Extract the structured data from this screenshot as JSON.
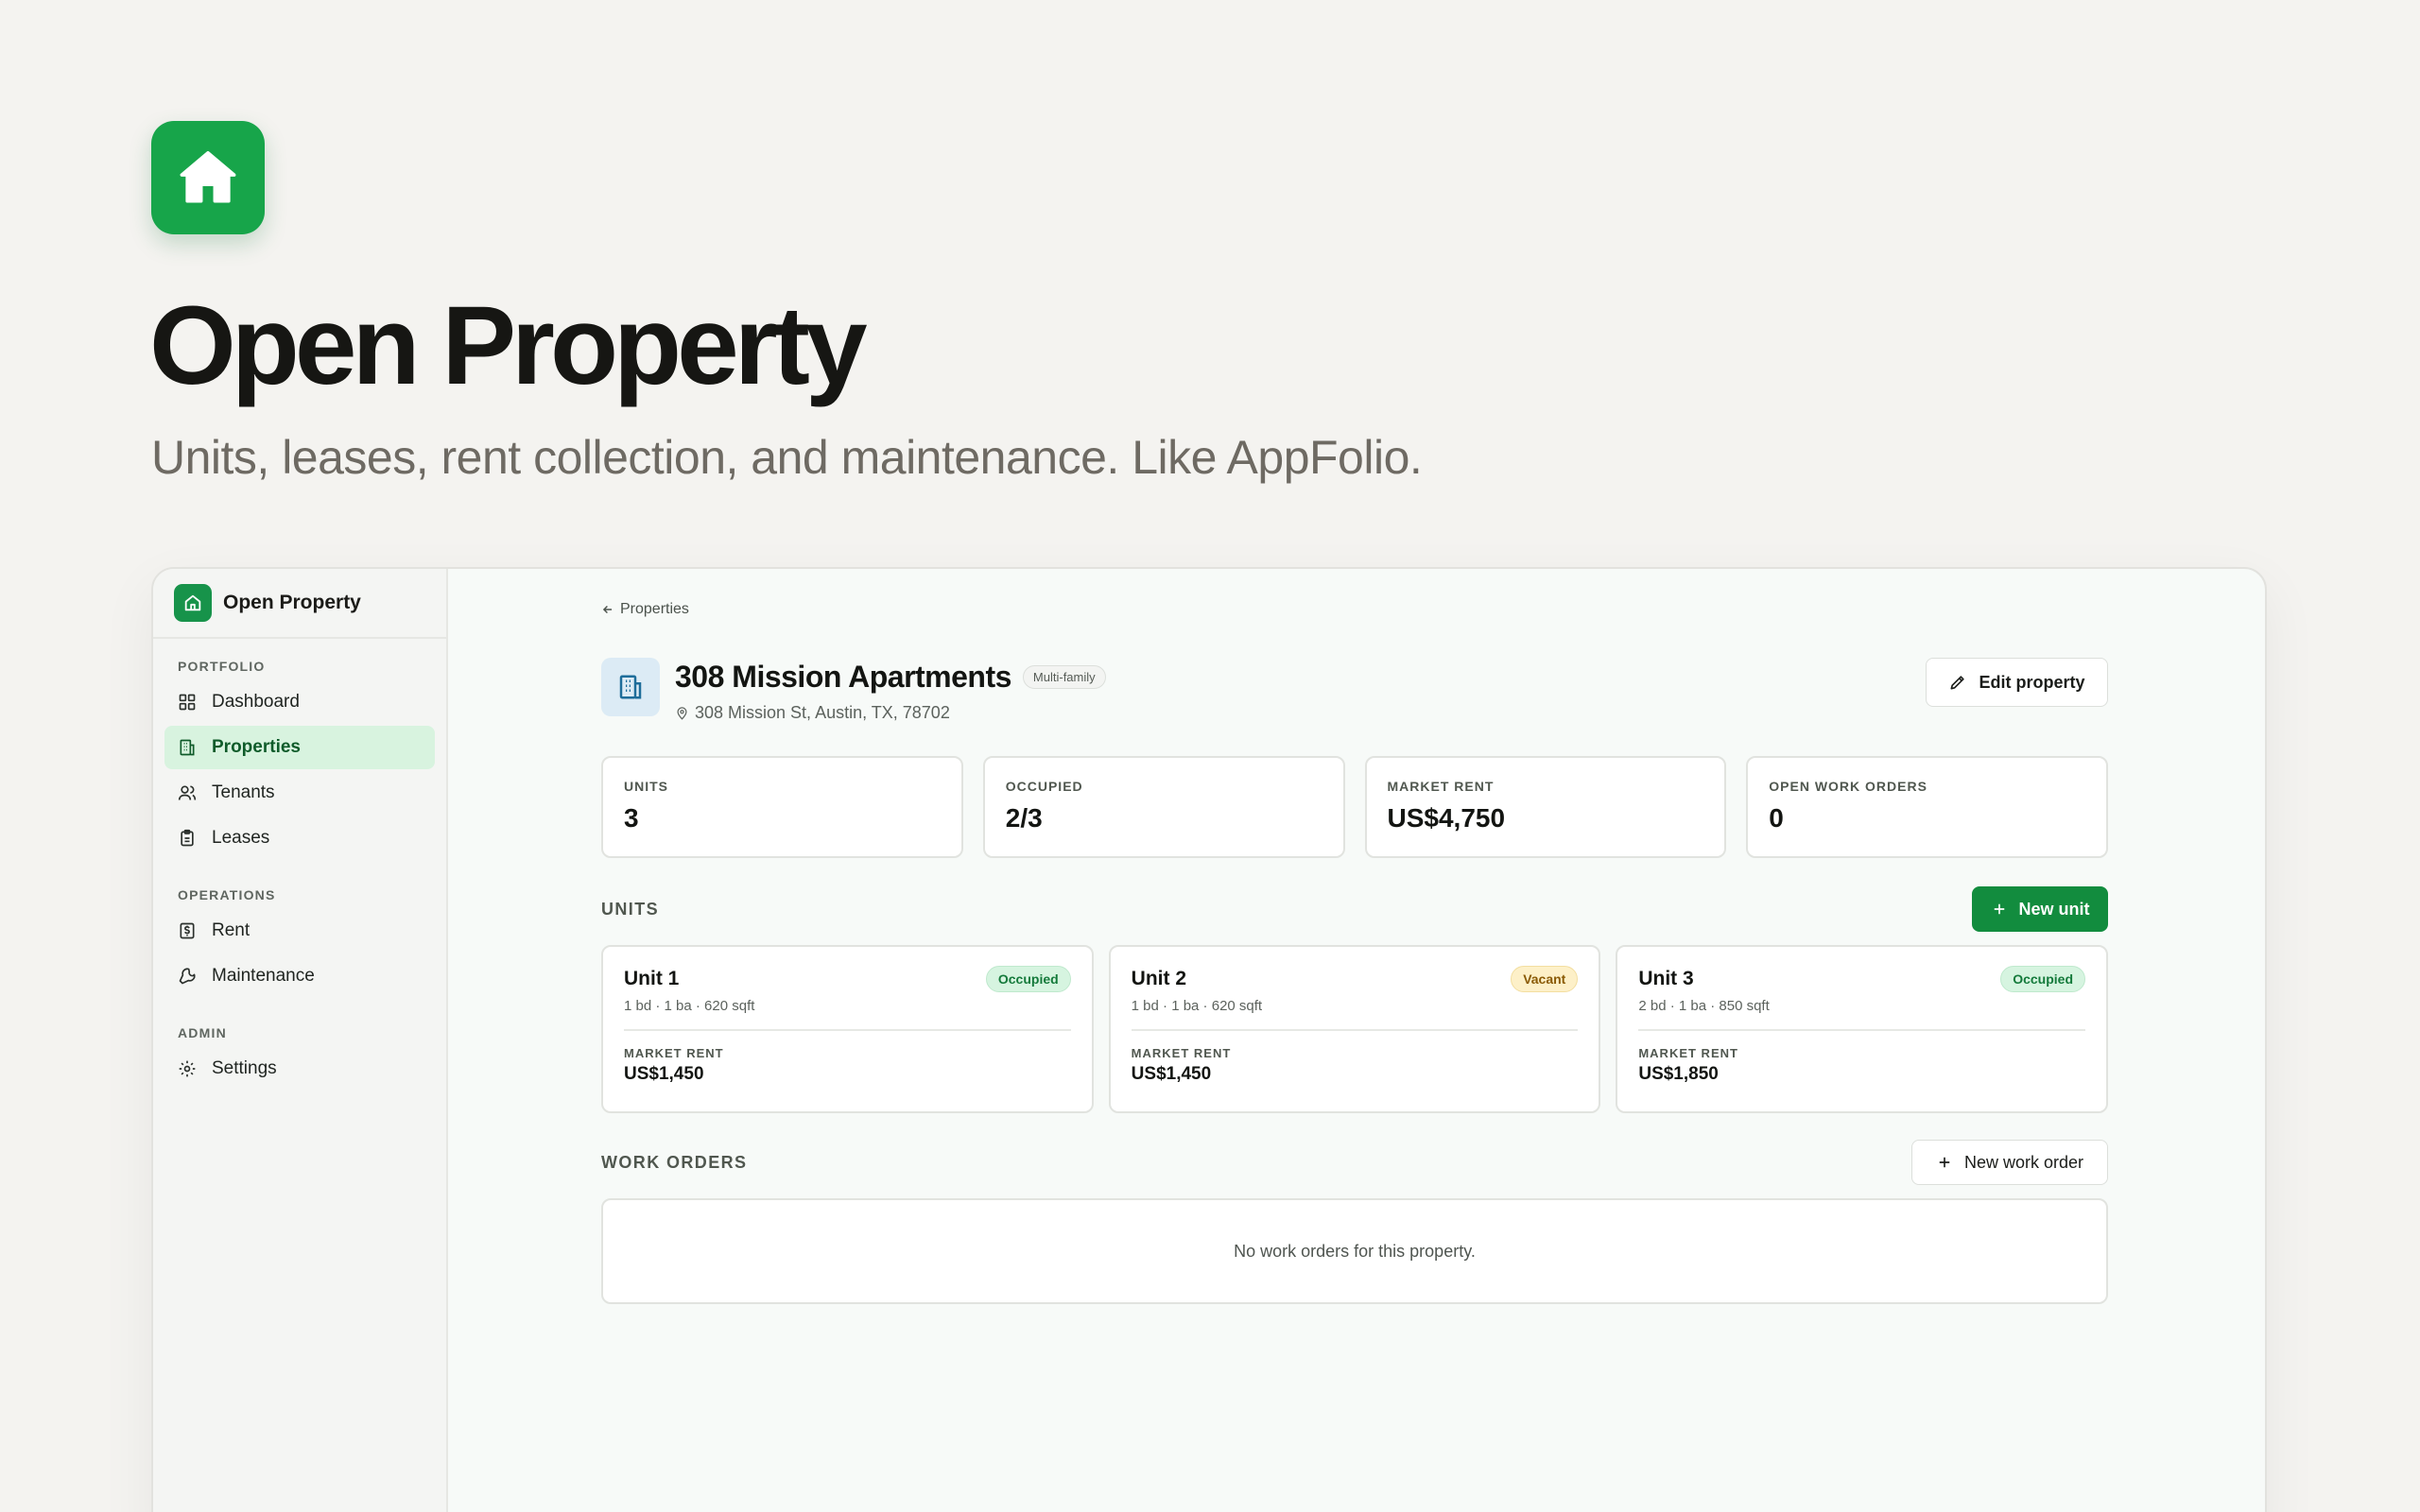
{
  "hero": {
    "title": "Open Property",
    "tagline": "Units, leases, rent collection, and maintenance. Like AppFolio."
  },
  "colors": {
    "brand_green": "#17a54a",
    "primary_button": "#128c3e",
    "active_nav_bg": "#d8f3df",
    "occupied_badge": "#d6f4e0",
    "vacant_badge": "#fdf0c8"
  },
  "sidebar": {
    "brand": "Open Property",
    "sections": [
      {
        "label": "PORTFOLIO",
        "items": [
          {
            "label": "Dashboard",
            "icon": "grid-icon"
          },
          {
            "label": "Properties",
            "icon": "building-icon",
            "active": true
          },
          {
            "label": "Tenants",
            "icon": "users-icon"
          },
          {
            "label": "Leases",
            "icon": "clipboard-icon"
          }
        ]
      },
      {
        "label": "OPERATIONS",
        "items": [
          {
            "label": "Rent",
            "icon": "dollar-receipt-icon"
          },
          {
            "label": "Maintenance",
            "icon": "wrench-icon"
          }
        ]
      },
      {
        "label": "ADMIN",
        "items": [
          {
            "label": "Settings",
            "icon": "gear-icon"
          }
        ]
      }
    ]
  },
  "main": {
    "breadcrumb": "Properties",
    "property": {
      "name": "308 Mission Apartments",
      "type": "Multi-family",
      "address": "308 Mission St, Austin, TX, 78702"
    },
    "edit_button": "Edit property",
    "stats": [
      {
        "label": "UNITS",
        "value": "3"
      },
      {
        "label": "OCCUPIED",
        "value": "2/3"
      },
      {
        "label": "MARKET RENT",
        "value": "US$4,750"
      },
      {
        "label": "OPEN WORK ORDERS",
        "value": "0"
      }
    ],
    "units_section": {
      "label": "UNITS",
      "new_button": "New unit",
      "units": [
        {
          "name": "Unit 1",
          "status": "Occupied",
          "meta": "1 bd · 1 ba · 620 sqft",
          "rent_label": "MARKET RENT",
          "rent": "US$1,450"
        },
        {
          "name": "Unit 2",
          "status": "Vacant",
          "meta": "1 bd · 1 ba · 620 sqft",
          "rent_label": "MARKET RENT",
          "rent": "US$1,450"
        },
        {
          "name": "Unit 3",
          "status": "Occupied",
          "meta": "2 bd · 1 ba · 850 sqft",
          "rent_label": "MARKET RENT",
          "rent": "US$1,850"
        }
      ]
    },
    "work_orders": {
      "label": "WORK ORDERS",
      "new_button": "New work order",
      "empty_text": "No work orders for this property."
    }
  }
}
